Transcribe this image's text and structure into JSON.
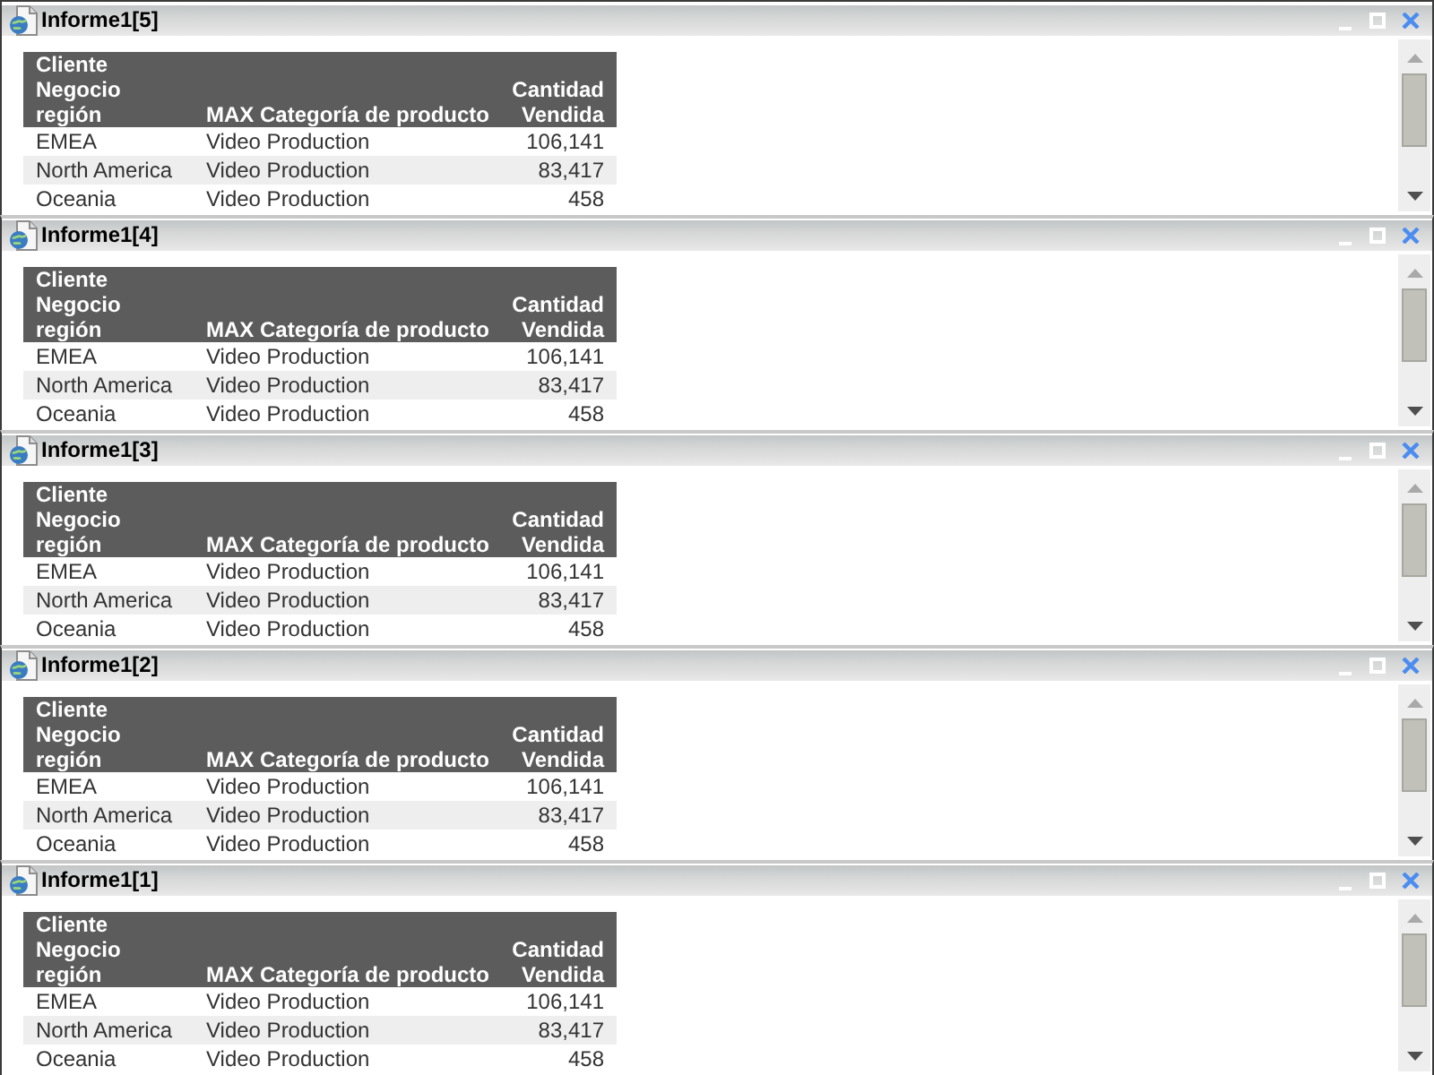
{
  "panels": [
    {
      "title": "Informe1[5]",
      "table": {
        "columns": [
          "Cliente Negocio región",
          "MAX Categoría de producto",
          "Cantidad Vendida"
        ],
        "rows": [
          [
            "EMEA",
            "Video Production",
            "106,141"
          ],
          [
            "North America",
            "Video Production",
            "83,417"
          ],
          [
            "Oceania",
            "Video Production",
            "458"
          ]
        ]
      }
    },
    {
      "title": "Informe1[4]",
      "table": {
        "columns": [
          "Cliente Negocio región",
          "MAX Categoría de producto",
          "Cantidad Vendida"
        ],
        "rows": [
          [
            "EMEA",
            "Video Production",
            "106,141"
          ],
          [
            "North America",
            "Video Production",
            "83,417"
          ],
          [
            "Oceania",
            "Video Production",
            "458"
          ]
        ]
      }
    },
    {
      "title": "Informe1[3]",
      "table": {
        "columns": [
          "Cliente Negocio región",
          "MAX Categoría de producto",
          "Cantidad Vendida"
        ],
        "rows": [
          [
            "EMEA",
            "Video Production",
            "106,141"
          ],
          [
            "North America",
            "Video Production",
            "83,417"
          ],
          [
            "Oceania",
            "Video Production",
            "458"
          ]
        ]
      }
    },
    {
      "title": "Informe1[2]",
      "table": {
        "columns": [
          "Cliente Negocio región",
          "MAX Categoría de producto",
          "Cantidad Vendida"
        ],
        "rows": [
          [
            "EMEA",
            "Video Production",
            "106,141"
          ],
          [
            "North America",
            "Video Production",
            "83,417"
          ],
          [
            "Oceania",
            "Video Production",
            "458"
          ]
        ]
      }
    },
    {
      "title": "Informe1[1]",
      "table": {
        "columns": [
          "Cliente Negocio región",
          "MAX Categoría de producto",
          "Cantidad Vendida"
        ],
        "rows": [
          [
            "EMEA",
            "Video Production",
            "106,141"
          ],
          [
            "North America",
            "Video Production",
            "83,417"
          ],
          [
            "Oceania",
            "Video Production",
            "458"
          ]
        ]
      }
    }
  ]
}
